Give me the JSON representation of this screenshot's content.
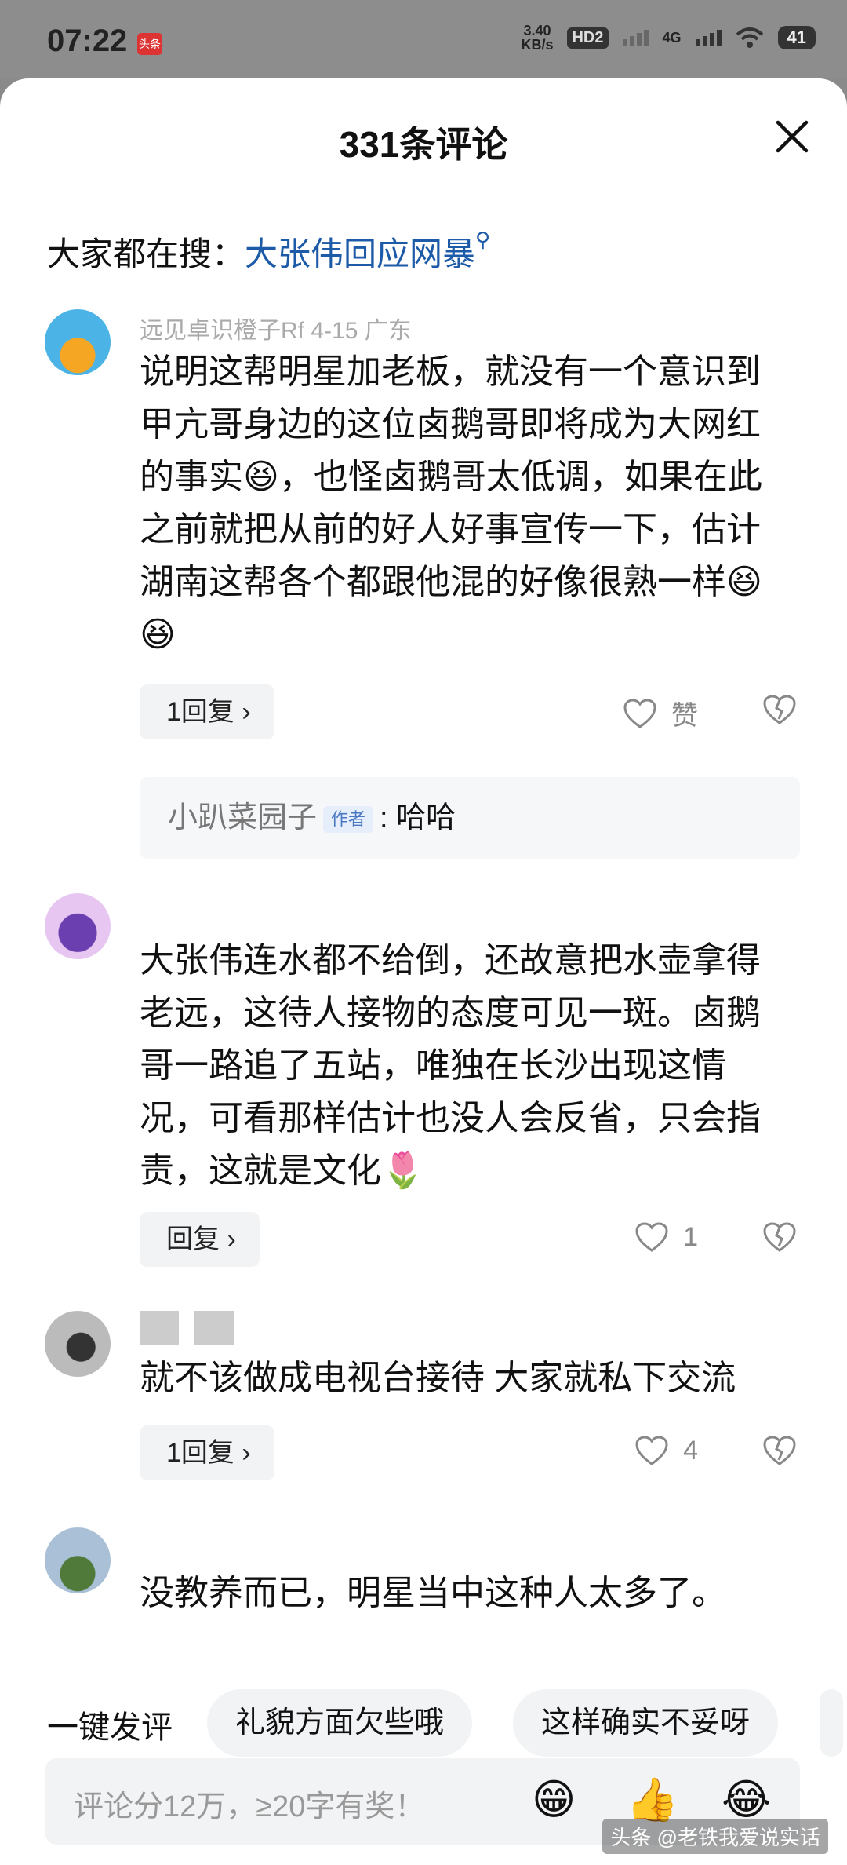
{
  "status_bar": {
    "time": "07:22",
    "app_badge": "头条",
    "net_speed_value": "3.40",
    "net_speed_unit": "KB/s",
    "hd": "HD2",
    "network": "4G",
    "battery": "41"
  },
  "sheet": {
    "title": "331条评论",
    "search_prefix": "大家都在搜：",
    "search_link": "大张伟回应网暴"
  },
  "comments": [
    {
      "meta": "远见卓识橙子Rf  4-15  广东",
      "text": "说明这帮明星加老板，就没有一个意识到甲亢哥身边的这位卤鹅哥即将成为大网红的事实😆，也怪卤鹅哥太低调，如果在此之前就把从前的好人好事宣传一下，估计湖南这帮各个都跟他混的好像很熟一样😆😆",
      "reply_label": "1回复 ›",
      "like_label": "赞",
      "sub_reply": {
        "name": "小趴菜园子",
        "badge": "作者",
        "text": ": 哈哈"
      }
    },
    {
      "meta": "",
      "text": "大张伟连水都不给倒，还故意把水壶拿得老远，这待人接物的态度可见一斑。卤鹅哥一路追了五站，唯独在长沙出现这情况，可看那样估计也没人会反省，只会指责，这就是文化🌷",
      "reply_label": "回复 ›",
      "like_label": "1"
    },
    {
      "meta": "",
      "text": "就不该做成电视台接待 大家就私下交流",
      "reply_label": "1回复 ›",
      "like_label": "4"
    },
    {
      "meta": "",
      "text": "没教养而已，明星当中这种人太多了。"
    }
  ],
  "quick_reply": {
    "label": "一键发评",
    "chips": [
      "礼貌方面欠些哦",
      "这样确实不妥呀"
    ]
  },
  "input": {
    "placeholder": "评论分12万，≥20字有奖！"
  },
  "watermark": "头条 @老铁我爱说实话"
}
